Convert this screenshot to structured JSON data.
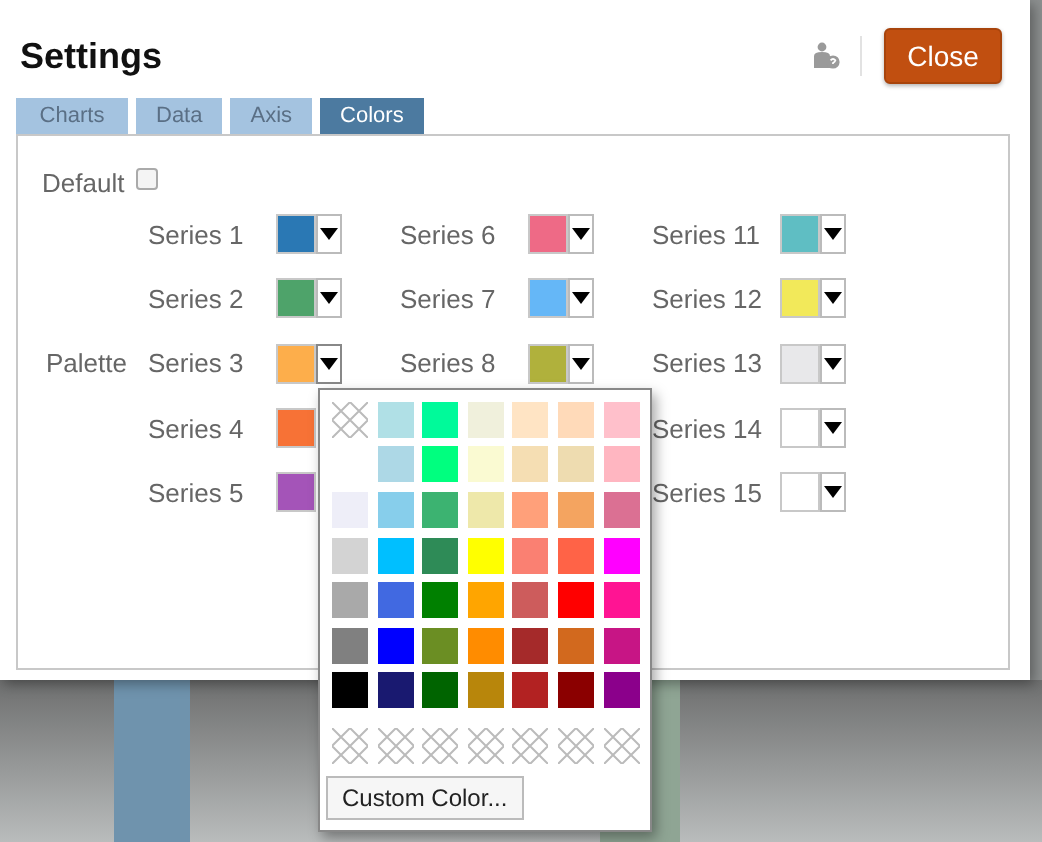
{
  "dialog": {
    "title": "Settings",
    "close_label": "Close"
  },
  "tabs": [
    {
      "label": "Charts",
      "selected": false
    },
    {
      "label": "Data",
      "selected": false
    },
    {
      "label": "Axis",
      "selected": false
    },
    {
      "label": "Colors",
      "selected": true
    }
  ],
  "default": {
    "label": "Default",
    "checked": false
  },
  "palette_label": "Palette",
  "series_columns": [
    [
      {
        "label": "Series 1",
        "color": "#2a78b4",
        "open": false
      },
      {
        "label": "Series 2",
        "color": "#4ea36a",
        "open": false
      },
      {
        "label": "Series 3",
        "color": "#fdae4b",
        "open": true
      },
      {
        "label": "Series 4",
        "color": "#f77236"
      },
      {
        "label": "Series 5",
        "color": "#a454b8"
      }
    ],
    [
      {
        "label": "Series 6",
        "color": "#ee6a86",
        "open": false
      },
      {
        "label": "Series 7",
        "color": "#65b7f7",
        "open": false
      },
      {
        "label": "Series 8",
        "color": "#b0b13c",
        "open": false
      }
    ],
    [
      {
        "label": "Series 11",
        "color": "#5fbec3",
        "open": false
      },
      {
        "label": "Series 12",
        "color": "#f2e95a",
        "open": false
      },
      {
        "label": "Series 13",
        "color": "#e8e8ea",
        "open": false
      },
      {
        "label": "Series 14",
        "color": "#ffffff",
        "open": false
      },
      {
        "label": "Series 15",
        "color": "#ffffff",
        "open": false
      }
    ]
  ],
  "color_menu": {
    "rows": [
      [
        {
          "kind": "none"
        },
        {
          "kind": "color",
          "color": "#b0e0e6"
        },
        {
          "kind": "color",
          "color": "#00fa9a"
        },
        {
          "kind": "color",
          "color": "#f0f0dc"
        },
        {
          "kind": "color",
          "color": "#ffe4c4"
        },
        {
          "kind": "color",
          "color": "#ffdab9"
        },
        {
          "kind": "color",
          "color": "#ffc0cb"
        }
      ],
      [
        {
          "kind": "empty"
        },
        {
          "kind": "color",
          "color": "#add8e6"
        },
        {
          "kind": "color",
          "color": "#00ff7f"
        },
        {
          "kind": "color",
          "color": "#fafad2"
        },
        {
          "kind": "color",
          "color": "#f5deb3"
        },
        {
          "kind": "color",
          "color": "#eedcb0"
        },
        {
          "kind": "color",
          "color": "#ffb6c1"
        }
      ],
      [
        {
          "kind": "color",
          "color": "#eeeef8"
        },
        {
          "kind": "color",
          "color": "#87ceeb"
        },
        {
          "kind": "color",
          "color": "#3cb371"
        },
        {
          "kind": "color",
          "color": "#eee8aa"
        },
        {
          "kind": "color",
          "color": "#ffa07a"
        },
        {
          "kind": "color",
          "color": "#f4a460"
        },
        {
          "kind": "color",
          "color": "#db7093"
        }
      ],
      [
        {
          "kind": "color",
          "color": "#d3d3d3"
        },
        {
          "kind": "color",
          "color": "#00bfff"
        },
        {
          "kind": "color",
          "color": "#2e8b57"
        },
        {
          "kind": "color",
          "color": "#ffff00"
        },
        {
          "kind": "color",
          "color": "#fa8072"
        },
        {
          "kind": "color",
          "color": "#ff6347"
        },
        {
          "kind": "color",
          "color": "#ff00ff"
        }
      ],
      [
        {
          "kind": "color",
          "color": "#a9a9a9"
        },
        {
          "kind": "color",
          "color": "#4169e1"
        },
        {
          "kind": "color",
          "color": "#008000"
        },
        {
          "kind": "color",
          "color": "#ffa500"
        },
        {
          "kind": "color",
          "color": "#cd5c5c"
        },
        {
          "kind": "color",
          "color": "#ff0000"
        },
        {
          "kind": "color",
          "color": "#ff1493"
        }
      ],
      [
        {
          "kind": "color",
          "color": "#808080"
        },
        {
          "kind": "color",
          "color": "#0000ff"
        },
        {
          "kind": "color",
          "color": "#6b8e23"
        },
        {
          "kind": "color",
          "color": "#ff8c00"
        },
        {
          "kind": "color",
          "color": "#a52a2a"
        },
        {
          "kind": "color",
          "color": "#d2691e"
        },
        {
          "kind": "color",
          "color": "#c71585"
        }
      ],
      [
        {
          "kind": "color",
          "color": "#000000"
        },
        {
          "kind": "color",
          "color": "#191970"
        },
        {
          "kind": "color",
          "color": "#006400"
        },
        {
          "kind": "color",
          "color": "#b8860b"
        },
        {
          "kind": "color",
          "color": "#b22222"
        },
        {
          "kind": "color",
          "color": "#8b0000"
        },
        {
          "kind": "color",
          "color": "#8b008b"
        }
      ]
    ],
    "custom_slots": [
      {
        "kind": "none"
      },
      {
        "kind": "none"
      },
      {
        "kind": "none"
      },
      {
        "kind": "none"
      },
      {
        "kind": "none"
      },
      {
        "kind": "none"
      },
      {
        "kind": "none"
      }
    ],
    "button": "Custom Color..."
  }
}
